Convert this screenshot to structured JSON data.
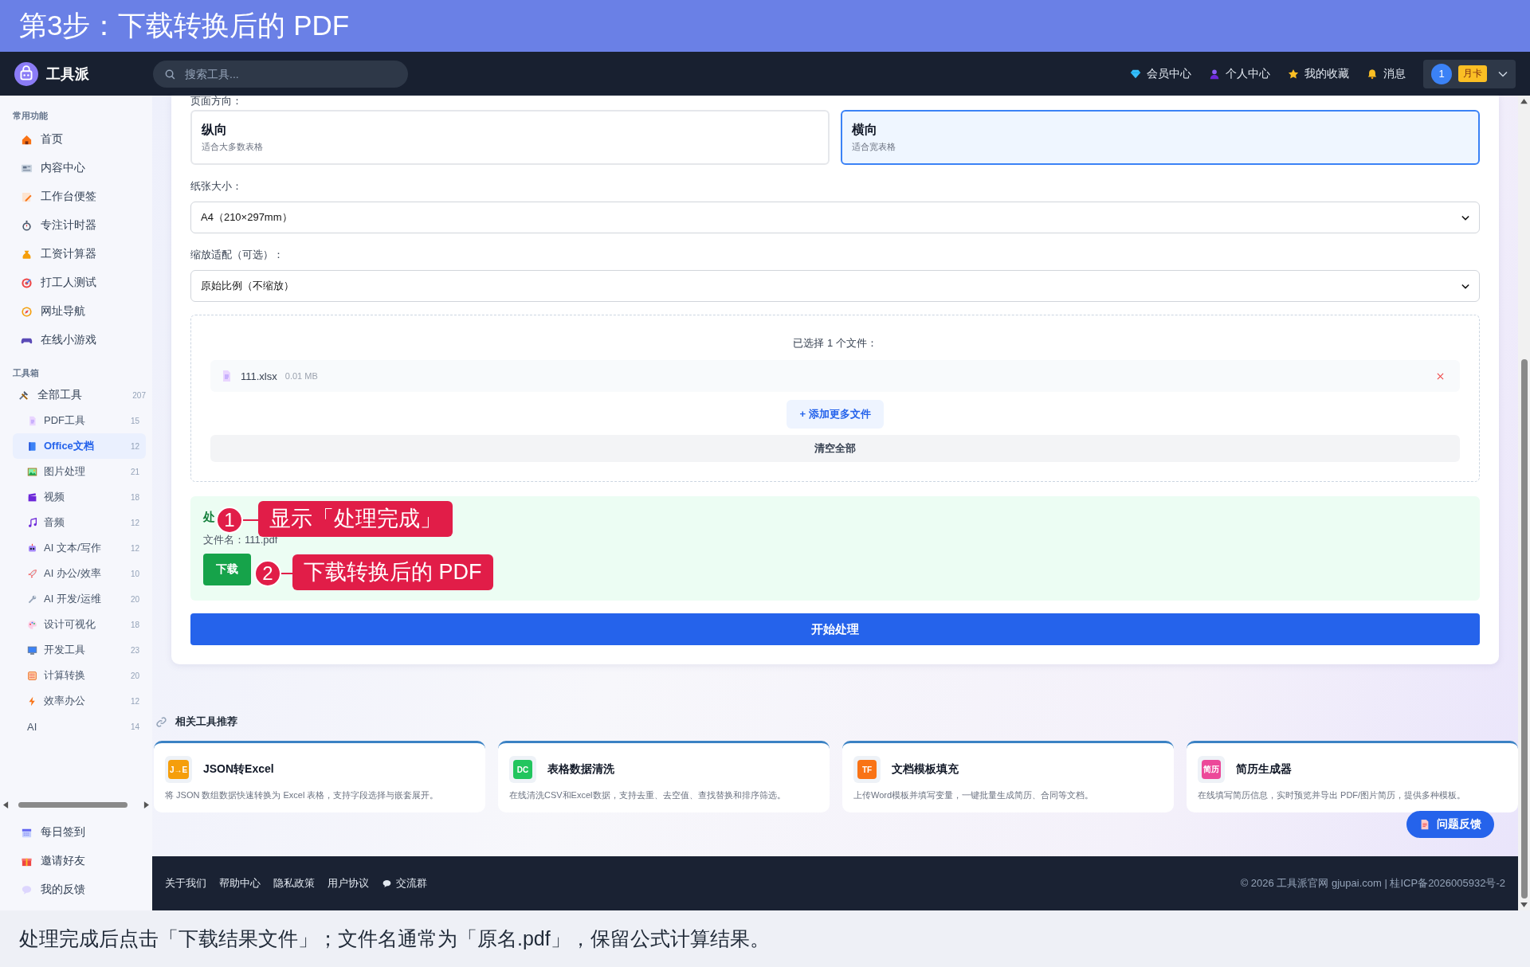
{
  "banner": {
    "title": "第3步：下载转换后的 PDF"
  },
  "header": {
    "logo": "工具派",
    "search": {
      "placeholder": "搜索工具..."
    },
    "nav": [
      {
        "label": "会员中心"
      },
      {
        "label": "个人中心"
      },
      {
        "label": "我的收藏"
      },
      {
        "label": "消息"
      }
    ],
    "user": {
      "avatar": "1",
      "badge": "月卡"
    }
  },
  "sidebar": {
    "sections": [
      {
        "title": "常用功能",
        "items": [
          {
            "label": "首页",
            "selected": false
          },
          {
            "label": "内容中心",
            "selected": false
          },
          {
            "label": "工作台便签",
            "selected": false
          },
          {
            "label": "专注计时器",
            "selected": false
          },
          {
            "label": "工资计算器",
            "selected": false
          },
          {
            "label": "打工人测试",
            "selected": false
          },
          {
            "label": "网址导航",
            "selected": false
          },
          {
            "label": "在线小游戏",
            "selected": false
          }
        ]
      },
      {
        "title": "工具箱",
        "items": [
          {
            "label": "全部工具",
            "count": "207",
            "selected": false,
            "children": [
              {
                "label": "PDF工具",
                "count": "15",
                "selected": false
              },
              {
                "label": "Office文档",
                "count": "12",
                "selected": true
              },
              {
                "label": "图片处理",
                "count": "21",
                "selected": false
              },
              {
                "label": "视频",
                "count": "18",
                "selected": false
              },
              {
                "label": "音频",
                "count": "12",
                "selected": false
              },
              {
                "label": "AI 文本/写作",
                "count": "12",
                "selected": false
              },
              {
                "label": "AI 办公/效率",
                "count": "10",
                "selected": false
              },
              {
                "label": "AI 开发/运维",
                "count": "20",
                "selected": false
              },
              {
                "label": "设计可视化",
                "count": "18",
                "selected": false
              },
              {
                "label": "开发工具",
                "count": "23",
                "selected": false
              },
              {
                "label": "计算转换",
                "count": "20",
                "selected": false
              },
              {
                "label": "效率办公",
                "count": "12",
                "selected": false
              },
              {
                "label": "AI",
                "count": "14",
                "selected": false
              }
            ]
          }
        ]
      }
    ],
    "footer_items": [
      {
        "label": "每日签到"
      },
      {
        "label": "邀请好友"
      },
      {
        "label": "我的反馈"
      }
    ]
  },
  "form": {
    "orientation_label": "页面方向：",
    "orientations": [
      {
        "title": "纵向",
        "subtitle": "适合大多数表格",
        "selected": false
      },
      {
        "title": "横向",
        "subtitle": "适合宽表格",
        "selected": true
      }
    ],
    "paper": {
      "label": "纸张大小：",
      "value": "A4（210×297mm）"
    },
    "scale": {
      "label": "缩放适配（可选）：",
      "value": "原始比例（不缩放）"
    },
    "files": {
      "heading": "已选择 1 个文件：",
      "items": [
        {
          "name": "111.xlsx",
          "size": "0.01 MB"
        }
      ],
      "add_button": "+ 添加更多文件",
      "clear_button": "清空全部"
    },
    "result": {
      "title": "处",
      "filename": "文件名：111.pdf",
      "download_button": "下载"
    },
    "start_button": "开始处理"
  },
  "related": {
    "title": "相关工具推荐",
    "cards": [
      {
        "badge": "J→E",
        "color": "#f59e0b",
        "name": "JSON转Excel",
        "description": "将 JSON 数组数据快速转换为 Excel 表格，支持字段选择与嵌套展开。"
      },
      {
        "badge": "DC",
        "color": "#22c55e",
        "name": "表格数据清洗",
        "description": "在线清洗CSV和Excel数据，支持去重、去空值、查找替换和排序筛选。"
      },
      {
        "badge": "TF",
        "color": "#f97316",
        "name": "文档模板填充",
        "description": "上传Word模板并填写变量，一键批量生成简历、合同等文档。"
      },
      {
        "badge": "简历",
        "color": "#ec4899",
        "name": "简历生成器",
        "description": "在线填写简历信息，实时预览并导出 PDF/图片简历，提供多种模板。"
      }
    ]
  },
  "feedback_button": "问题反馈",
  "footer": {
    "links": [
      {
        "label": "关于我们",
        "chat_icon": false
      },
      {
        "label": "帮助中心",
        "chat_icon": false
      },
      {
        "label": "隐私政策",
        "chat_icon": false
      },
      {
        "label": "用户协议",
        "chat_icon": false
      },
      {
        "label": "交流群",
        "chat_icon": true
      }
    ],
    "copyright": "© 2026 工具派官网 gjupai.com | 桂ICP备2026005932号-2"
  },
  "annotations": [
    {
      "number": "1",
      "text": "显示「处理完成」"
    },
    {
      "number": "2",
      "text": "下载转换后的 PDF"
    }
  ],
  "caption": "处理完成后点击「下载结果文件」；文件名通常为「原名.pdf」，保留公式计算结果。"
}
